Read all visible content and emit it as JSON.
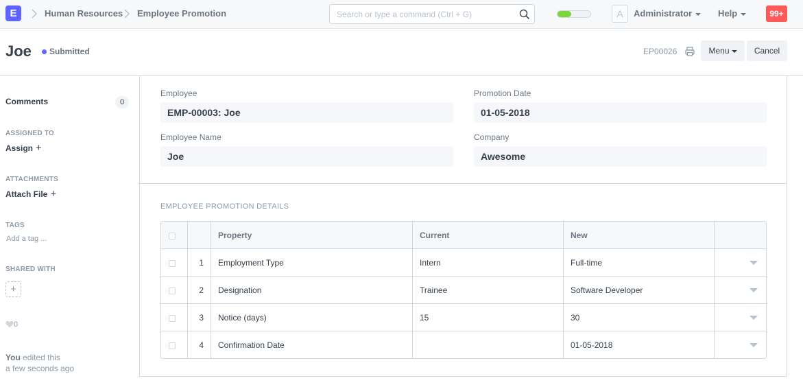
{
  "navbar": {
    "logo_letter": "E",
    "breadcrumbs": [
      "Human Resources",
      "Employee Promotion"
    ],
    "search_placeholder": "Search or type a command (Ctrl + G)",
    "progress_fraction": 0.42,
    "progress_color": "#7cd43e",
    "avatar_letter": "A",
    "user_label": "Administrator",
    "help_label": "Help",
    "notifications_label": "99+"
  },
  "page": {
    "title": "Joe",
    "status": "Submitted",
    "status_color": "#5e64ff",
    "doc_name": "EP00026",
    "menu_label": "Menu",
    "cancel_label": "Cancel"
  },
  "sidebar": {
    "comments_label": "Comments",
    "comments_count": "0",
    "assigned_to_label": "ASSIGNED TO",
    "assign_label": "Assign",
    "attachments_label": "ATTACHMENTS",
    "attach_label": "Attach File",
    "tags_label": "TAGS",
    "tag_placeholder": "Add a tag ...",
    "shared_with_label": "SHARED WITH",
    "like_count": "0",
    "edited_by": "You",
    "edited_text": "edited this",
    "edited_time": "a few seconds ago"
  },
  "form": {
    "employee_label": "Employee",
    "employee_value": "EMP-00003: Joe",
    "promotion_date_label": "Promotion Date",
    "promotion_date_value": "01-05-2018",
    "employee_name_label": "Employee Name",
    "employee_name_value": "Joe",
    "company_label": "Company",
    "company_value": "Awesome",
    "section_title": "EMPLOYEE PROMOTION DETAILS",
    "table": {
      "columns": [
        "Property",
        "Current",
        "New"
      ],
      "rows": [
        {
          "idx": "1",
          "property": "Employment Type",
          "current": "Intern",
          "new": "Full-time"
        },
        {
          "idx": "2",
          "property": "Designation",
          "current": "Trainee",
          "new": "Software Developer"
        },
        {
          "idx": "3",
          "property": "Notice (days)",
          "current": "15",
          "new": "30"
        },
        {
          "idx": "4",
          "property": "Confirmation Date",
          "current": "",
          "new": "01-05-2018"
        }
      ]
    }
  }
}
